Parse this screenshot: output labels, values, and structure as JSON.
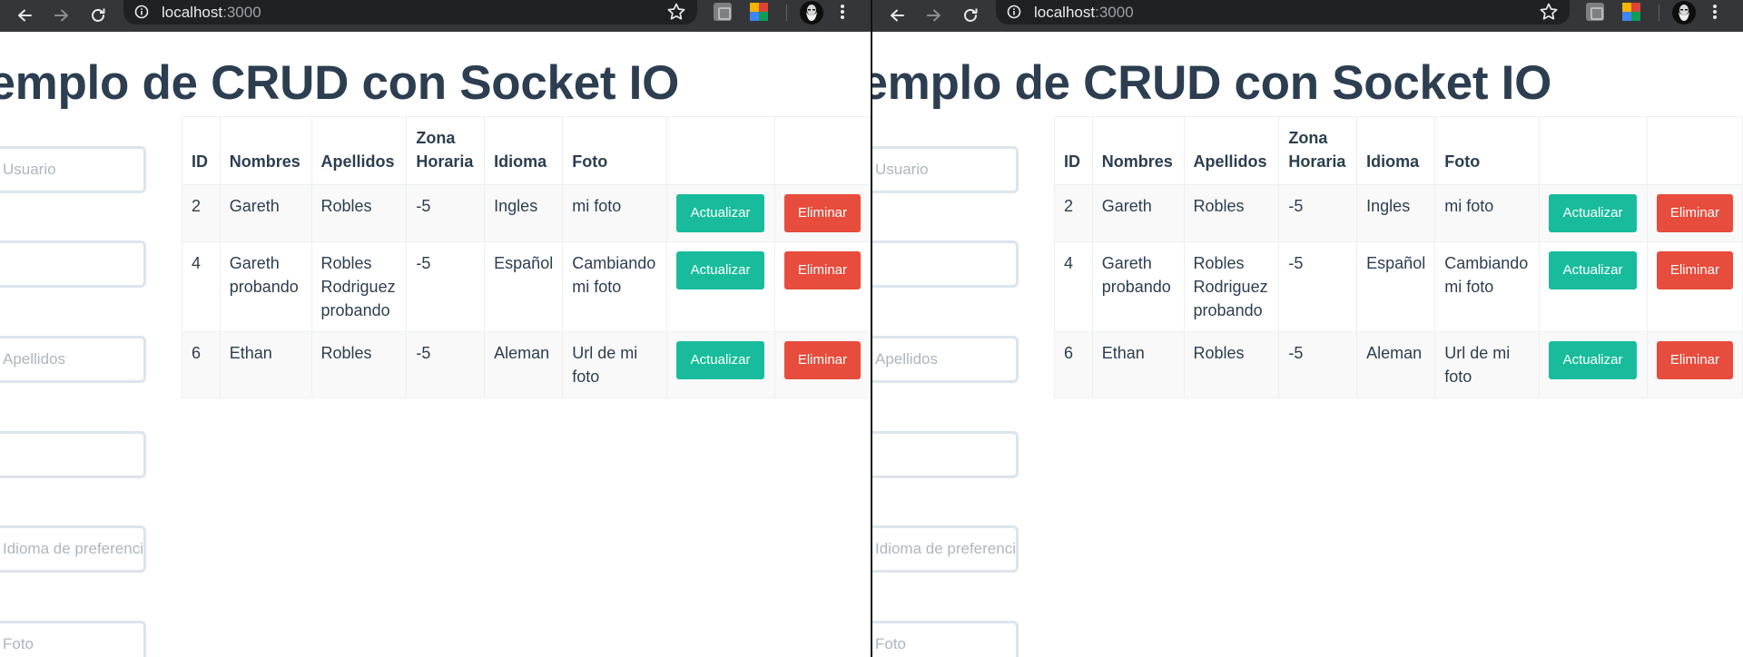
{
  "browser": {
    "url_host": "localhost",
    "url_port": ":3000"
  },
  "page": {
    "title": "Ejemplo de CRUD con Socket IO"
  },
  "form": {
    "placeholders": [
      "Usuario",
      "",
      "Apellidos",
      "",
      "Idioma de preferencia",
      "Foto"
    ]
  },
  "table": {
    "headers": [
      "ID",
      "Nombres",
      "Apellidos",
      "Zona Horaria",
      "Idioma",
      "Foto"
    ],
    "rows": [
      {
        "id": "2",
        "nombres": "Gareth",
        "apellidos": "Robles",
        "zona": "-5",
        "idioma": "Ingles",
        "foto": "mi foto"
      },
      {
        "id": "4",
        "nombres": "Gareth probando",
        "apellidos": "Robles Rodriguez probando",
        "zona": "-5",
        "idioma": "Español",
        "foto": "Cambiando mi foto"
      },
      {
        "id": "6",
        "nombres": "Ethan",
        "apellidos": "Robles",
        "zona": "-5",
        "idioma": "Aleman",
        "foto": "Url de mi foto"
      }
    ],
    "update_label": "Actualizar",
    "delete_label": "Eliminar"
  },
  "colors": {
    "update": "#18bc9c",
    "delete": "#e74c3c",
    "text": "#2c3e50"
  },
  "icons": [
    "back-arrow-icon",
    "forward-arrow-icon",
    "reload-icon",
    "info-icon",
    "star-icon",
    "extension-icon",
    "color-extension-icon",
    "avatar",
    "menu-icon"
  ]
}
